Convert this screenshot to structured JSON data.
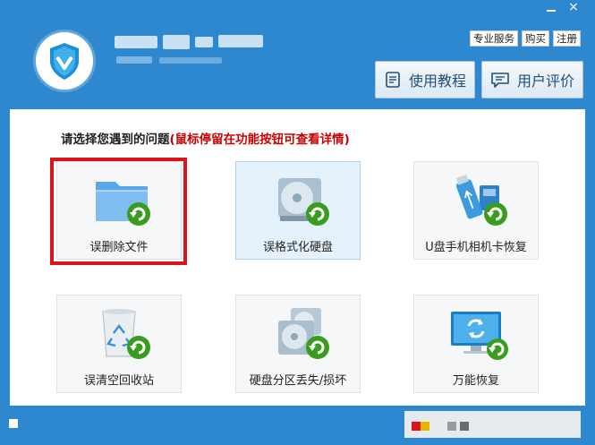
{
  "window_controls": {
    "minimize": "",
    "close": "×"
  },
  "header": {
    "top_links": [
      "专业服务",
      "购买",
      "注册"
    ],
    "buttons": {
      "tutorial": "使用教程",
      "review": "用户评价"
    }
  },
  "main": {
    "prompt": "请选择您遇到的问题",
    "hint": "(鼠标停留在功能按钮可查看详情)",
    "cards": [
      {
        "label": "误删除文件",
        "icon": "folder-restore-icon"
      },
      {
        "label": "误格式化硬盘",
        "icon": "disk-format-restore-icon"
      },
      {
        "label": "U盘手机相机卡恢复",
        "icon": "usb-card-restore-icon"
      },
      {
        "label": "误清空回收站",
        "icon": "recycle-bin-restore-icon"
      },
      {
        "label": "硬盘分区丢失/损坏",
        "icon": "partition-restore-icon"
      },
      {
        "label": "万能恢复",
        "icon": "monitor-restore-icon"
      }
    ]
  },
  "colors": {
    "accent": "#2d88cf",
    "highlight": "#d9141b",
    "hint_red": "#cc0000",
    "arrow_green": "#3a9c1c"
  }
}
